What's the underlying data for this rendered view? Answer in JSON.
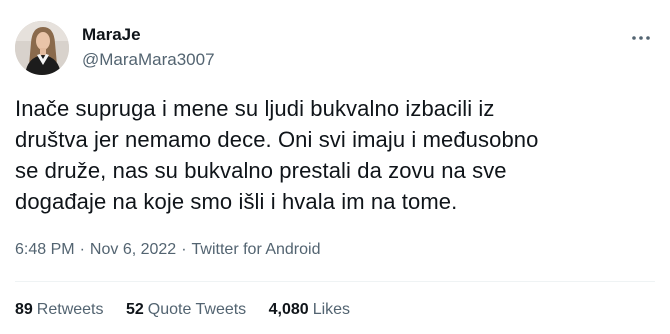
{
  "user": {
    "display_name": "MaraJe",
    "handle": "@MaraMara3007",
    "avatar_icon": "profile-photo"
  },
  "more_icon": "more-horizontal-icon",
  "tweet": {
    "lines": [
      "Inače supruga i mene su ljudi bukvalno izbacili iz",
      "društva jer nemamo dece. Oni svi imaju i međusobno",
      "se druže, nas su bukvalno prestali da zovu na sve",
      "događaje na koje smo išli i hvala im na tome."
    ]
  },
  "meta": {
    "time": "6:48 PM",
    "separator": "·",
    "date": "Nov 6, 2022",
    "source": "Twitter for Android"
  },
  "stats": {
    "retweets": {
      "count": "89",
      "label": "Retweets"
    },
    "quotes": {
      "count": "52",
      "label": "Quote Tweets"
    },
    "likes": {
      "count": "4,080",
      "label": "Likes"
    }
  },
  "colors": {
    "text": "#0f1419",
    "secondary": "#536471",
    "divider": "#eff3f4"
  }
}
